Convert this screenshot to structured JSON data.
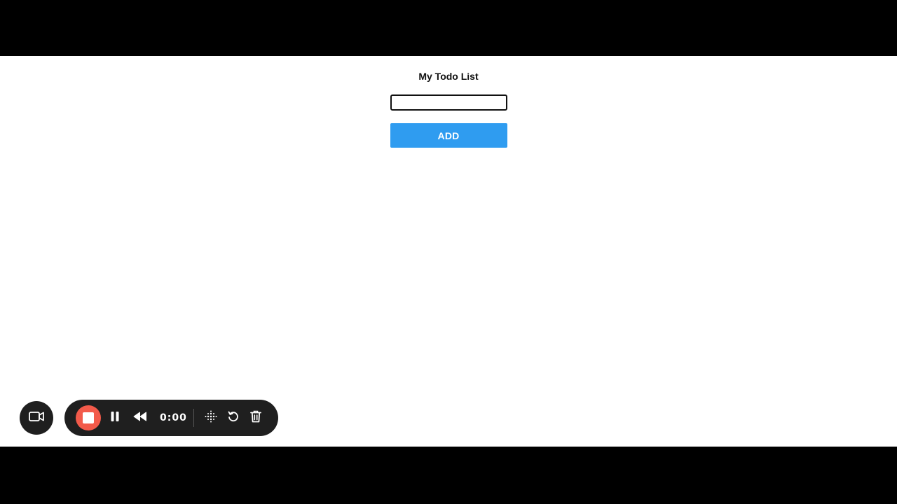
{
  "app": {
    "title": "My Todo List",
    "input": {
      "value": "",
      "placeholder": ""
    },
    "add_label": "ADD"
  },
  "recorder": {
    "timer": "0:00",
    "icons": {
      "camera": "video-camera-icon",
      "stop": "stop-icon",
      "pause": "pause-icon",
      "rewind": "rewind-icon",
      "grid": "dot-grid-icon",
      "undo": "undo-icon",
      "trash": "trash-icon"
    },
    "colors": {
      "toolbar_bg": "#1f1f1f",
      "stop": "#f25a4a"
    }
  },
  "colors": {
    "add_button": "#2f9cf0",
    "page_bg": "#ffffff",
    "letterbox": "#000000"
  }
}
